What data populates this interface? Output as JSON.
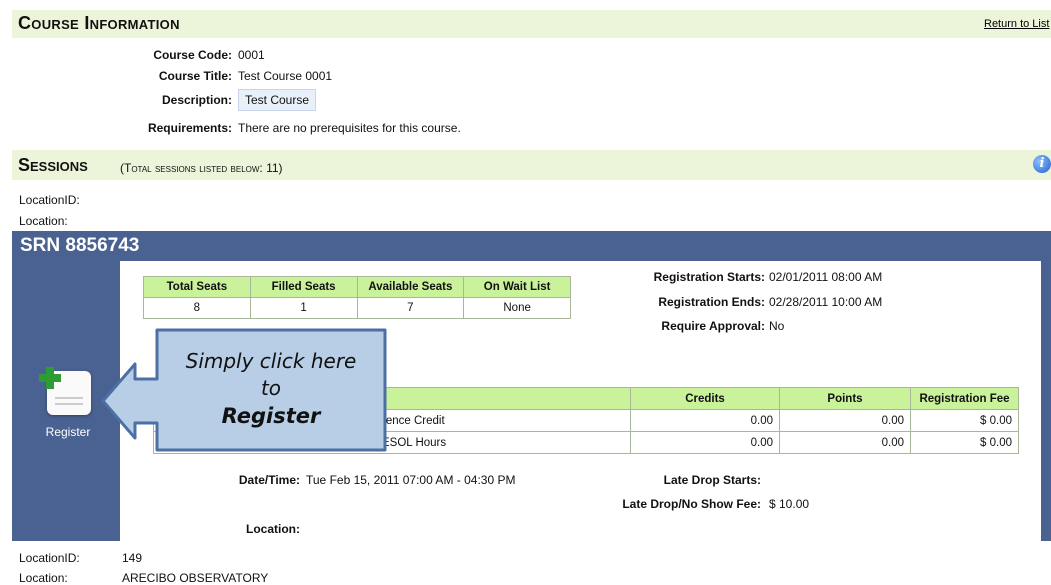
{
  "course_info": {
    "title": "Course Information",
    "return_link": "Return to List",
    "fields": {
      "code_label": "Course Code:",
      "code_value": "0001",
      "title_label": "Course Title:",
      "title_value": "Test Course 0001",
      "desc_label": "Description:",
      "desc_value": "Test Course",
      "req_label": "Requirements:",
      "req_value": "There are no prerequisites for this course."
    }
  },
  "sessions": {
    "title": "Sessions",
    "subtitle": "(Total sessions listed below: 11)",
    "info_icon": "info-icon",
    "location_id_label": "LocationID:",
    "location_label": "Location:"
  },
  "srn": {
    "title": "SRN 8856743",
    "register_label": "Register",
    "register_icon": "register-icon",
    "seats": {
      "headers": [
        "Total Seats",
        "Filled Seats",
        "Available Seats",
        "On Wait List"
      ],
      "values": [
        "8",
        "1",
        "7",
        "None"
      ]
    },
    "registration": {
      "starts_label": "Registration Starts:",
      "starts_value": "02/01/2011 08:00 AM",
      "ends_label": "Registration Ends:",
      "ends_value": "02/28/2011 10:00 AM",
      "approval_label": "Require Approval:",
      "approval_value": "No"
    },
    "credits": {
      "headers": [
        "",
        "Credits",
        "Points",
        "Registration Fee"
      ],
      "rows": [
        {
          "name": "rence Credit",
          "credits": "0.00",
          "points": "0.00",
          "fee": "$ 0.00"
        },
        {
          "name": "ESOL Hours",
          "credits": "0.00",
          "points": "0.00",
          "fee": "$ 0.00"
        }
      ]
    },
    "datetime_label": "Date/Time:",
    "datetime_value": "Tue Feb 15, 2011 07:00 AM - 04:30 PM",
    "late_drop_label": "Late Drop Starts:",
    "late_drop_value": "",
    "fee_label": "Late Drop/No Show Fee:",
    "fee_value": "$ 10.00",
    "location_label": "Location:"
  },
  "callout": {
    "line1": "Simply click here",
    "line2": "to",
    "line3": "Register"
  },
  "footer": {
    "location_id_label": "LocationID:",
    "location_id_value": "149",
    "location_label": "Location:",
    "location_value": "ARECIBO OBSERVATORY"
  },
  "colors": {
    "section_bg": "#ecf5d9",
    "srn_bar": "#4a6291",
    "table_header": "#c9f29a",
    "callout_fill": "#b8cde6"
  }
}
